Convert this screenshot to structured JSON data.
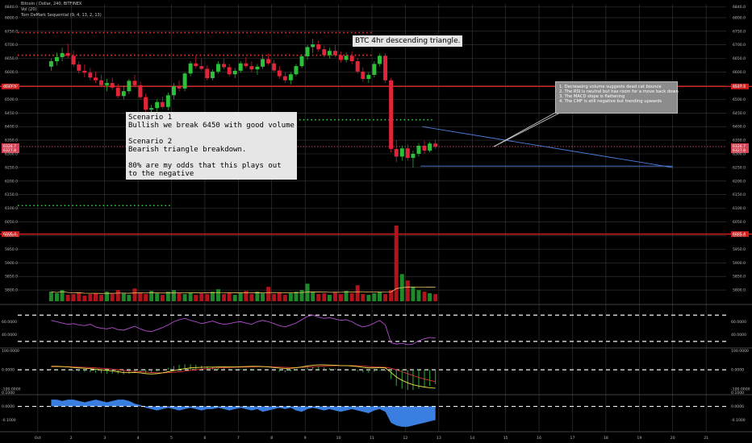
{
  "chart_data": {
    "type": "candlestick",
    "header": {
      "title": "Bitcoin / Dollar, 240, BITFINEX",
      "indicator_1": "Vol (20)",
      "indicator_2": "Tom DeMark Sequential (9, 4, 13, 2, 13)"
    },
    "annotations": {
      "title": "BTC 4hr descending triangle.",
      "scenarios": "Scenario 1\nBullish we break 6450 with good volume\n\nScenario 2\nBearish triangle breakdown.\n\n80% are my odds that this plays out\nto the negative",
      "callout": [
        "1. Decreasing volume suggests dead cat bounce",
        "2. The RSI is neutral but has room for a move back down",
        "3. The MACD slope is flattening",
        "4. The CMF is still negative but trending upwards"
      ]
    },
    "x_axis": {
      "ticks": [
        "Oct",
        "2",
        "3",
        "4",
        "5",
        "6",
        "7",
        "8",
        "9",
        "10",
        "11",
        "12",
        "13",
        "14",
        "15",
        "16",
        "17",
        "18",
        "19",
        "20",
        "21"
      ]
    },
    "price_axis": {
      "ylim": [
        5750,
        6850
      ],
      "ticks": [
        "6840.0",
        "6800.0",
        "6750.0",
        "6700.0",
        "6650.0",
        "6600.0",
        "6550.0",
        "6500.0",
        "6450.0",
        "6400.0",
        "6350.0",
        "6300.0",
        "6250.0",
        "6200.0",
        "6150.0",
        "6100.0",
        "6050.0",
        "6000.0",
        "5950.0",
        "5900.0",
        "5850.0",
        "5800.0"
      ],
      "levels": [
        6547.5,
        6005.4
      ],
      "level_labels": [
        "6547.5",
        "6005.4"
      ],
      "current_label": "6326.7",
      "current_label_2": "6327.8"
    },
    "support_resistance_dotted": [
      {
        "price": 6745,
        "color": "#ff3030"
      },
      {
        "price": 6662,
        "color": "#ff3030"
      },
      {
        "price": 6425,
        "color": "#2ecc40"
      },
      {
        "price": 6110,
        "color": "#2ecc40"
      }
    ],
    "triangle": {
      "upper": [
        [
          11.1,
          6400
        ],
        [
          18.6,
          6250
        ]
      ],
      "lower": [
        [
          11.05,
          6255
        ],
        [
          18.6,
          6255
        ]
      ]
    },
    "candles": [
      [
        0.0,
        6620,
        6650,
        6605,
        6640
      ],
      [
        0.17,
        6640,
        6672,
        6625,
        6655
      ],
      [
        0.33,
        6655,
        6690,
        6640,
        6670
      ],
      [
        0.5,
        6670,
        6705,
        6650,
        6660
      ],
      [
        0.67,
        6660,
        6680,
        6620,
        6628
      ],
      [
        0.83,
        6628,
        6640,
        6595,
        6605
      ],
      [
        1.0,
        6605,
        6628,
        6582,
        6598
      ],
      [
        1.17,
        6598,
        6615,
        6570,
        6580
      ],
      [
        1.33,
        6580,
        6602,
        6560,
        6570
      ],
      [
        1.5,
        6570,
        6590,
        6545,
        6552
      ],
      [
        1.67,
        6552,
        6575,
        6530,
        6560
      ],
      [
        1.83,
        6560,
        6580,
        6535,
        6543
      ],
      [
        2.0,
        6543,
        6558,
        6505,
        6512
      ],
      [
        2.17,
        6512,
        6550,
        6500,
        6530
      ],
      [
        2.33,
        6530,
        6575,
        6520,
        6568
      ],
      [
        2.5,
        6568,
        6590,
        6545,
        6552
      ],
      [
        2.67,
        6552,
        6565,
        6500,
        6508
      ],
      [
        2.83,
        6508,
        6520,
        6455,
        6462
      ],
      [
        3.0,
        6462,
        6480,
        6440,
        6468
      ],
      [
        3.17,
        6468,
        6500,
        6455,
        6490
      ],
      [
        3.33,
        6490,
        6510,
        6465,
        6472
      ],
      [
        3.5,
        6472,
        6525,
        6460,
        6515
      ],
      [
        3.67,
        6515,
        6560,
        6500,
        6548
      ],
      [
        3.83,
        6548,
        6570,
        6530,
        6540
      ],
      [
        4.0,
        6540,
        6600,
        6530,
        6595
      ],
      [
        4.17,
        6595,
        6640,
        6585,
        6632
      ],
      [
        4.33,
        6632,
        6660,
        6615,
        6622
      ],
      [
        4.5,
        6622,
        6650,
        6605,
        6612
      ],
      [
        4.67,
        6612,
        6625,
        6570,
        6578
      ],
      [
        4.83,
        6578,
        6610,
        6570,
        6602
      ],
      [
        5.0,
        6602,
        6640,
        6595,
        6630
      ],
      [
        5.17,
        6630,
        6650,
        6610,
        6618
      ],
      [
        5.33,
        6618,
        6630,
        6585,
        6592
      ],
      [
        5.5,
        6592,
        6615,
        6578,
        6605
      ],
      [
        5.67,
        6605,
        6640,
        6598,
        6632
      ],
      [
        5.83,
        6632,
        6655,
        6615,
        6622
      ],
      [
        6.0,
        6622,
        6640,
        6600,
        6610
      ],
      [
        6.17,
        6610,
        6630,
        6590,
        6620
      ],
      [
        6.33,
        6620,
        6660,
        6612,
        6648
      ],
      [
        6.5,
        6648,
        6668,
        6625,
        6632
      ],
      [
        6.67,
        6632,
        6645,
        6600,
        6606
      ],
      [
        6.83,
        6606,
        6622,
        6575,
        6585
      ],
      [
        7.0,
        6585,
        6600,
        6560,
        6570
      ],
      [
        7.17,
        6570,
        6600,
        6555,
        6592
      ],
      [
        7.33,
        6592,
        6630,
        6585,
        6622
      ],
      [
        7.5,
        6622,
        6665,
        6615,
        6658
      ],
      [
        7.67,
        6658,
        6700,
        6645,
        6692
      ],
      [
        7.83,
        6692,
        6722,
        6670,
        6702
      ],
      [
        8.0,
        6702,
        6715,
        6675,
        6684
      ],
      [
        8.17,
        6684,
        6698,
        6655,
        6662
      ],
      [
        8.33,
        6662,
        6690,
        6650,
        6678
      ],
      [
        8.5,
        6678,
        6700,
        6655,
        6662
      ],
      [
        8.67,
        6662,
        6675,
        6635,
        6645
      ],
      [
        8.83,
        6645,
        6672,
        6635,
        6660
      ],
      [
        9.0,
        6660,
        6675,
        6630,
        6640
      ],
      [
        9.17,
        6640,
        6652,
        6595,
        6602
      ],
      [
        9.33,
        6602,
        6618,
        6565,
        6575
      ],
      [
        9.5,
        6575,
        6600,
        6560,
        6590
      ],
      [
        9.67,
        6590,
        6640,
        6580,
        6630
      ],
      [
        9.83,
        6630,
        6668,
        6620,
        6660
      ],
      [
        10.0,
        6660,
        6670,
        6560,
        6570
      ],
      [
        10.17,
        6570,
        6578,
        6305,
        6318
      ],
      [
        10.33,
        6318,
        6350,
        6270,
        6290
      ],
      [
        10.5,
        6290,
        6330,
        6275,
        6320
      ],
      [
        10.67,
        6320,
        6335,
        6275,
        6285
      ],
      [
        10.83,
        6285,
        6312,
        6250,
        6300
      ],
      [
        11.0,
        6300,
        6340,
        6290,
        6330
      ],
      [
        11.17,
        6330,
        6348,
        6300,
        6312
      ],
      [
        11.33,
        6312,
        6345,
        6305,
        6338
      ],
      [
        11.5,
        6338,
        6352,
        6318,
        6326
      ]
    ],
    "x_domain": [
      -0.6,
      20.6
    ],
    "bar_x_offset": 0.4,
    "volume": [
      12,
      10,
      14,
      8,
      9,
      11,
      7,
      9,
      10,
      8,
      12,
      9,
      14,
      10,
      8,
      16,
      11,
      9,
      13,
      10,
      8,
      12,
      14,
      10,
      9,
      11,
      8,
      10,
      9,
      12,
      15,
      9,
      11,
      8,
      10,
      13,
      9,
      12,
      10,
      18,
      9,
      11,
      8,
      10,
      12,
      14,
      22,
      12,
      9,
      10,
      8,
      11,
      9,
      13,
      10,
      20,
      9,
      8,
      10,
      12,
      9,
      14,
      95,
      34,
      26,
      18,
      14,
      12,
      10,
      9
    ],
    "rsi": {
      "ylim": [
        20,
        85
      ],
      "ticks": [
        "60.0000",
        "40.0000"
      ],
      "guides": [
        70,
        30
      ],
      "values": [
        62,
        60,
        58,
        56,
        57,
        55,
        54,
        56,
        52,
        50,
        49,
        51,
        48,
        47,
        50,
        53,
        49,
        46,
        45,
        48,
        51,
        55,
        60,
        63,
        65,
        62,
        60,
        57,
        59,
        61,
        58,
        56,
        57,
        59,
        60,
        58,
        56,
        60,
        62,
        60,
        57,
        54,
        52,
        55,
        58,
        63,
        68,
        70,
        67,
        65,
        66,
        64,
        62,
        63,
        60,
        55,
        52,
        54,
        58,
        62,
        55,
        28,
        26,
        27,
        25,
        26,
        31,
        34,
        36,
        35
      ]
    },
    "macd": {
      "ylim": [
        -130,
        110
      ],
      "ticks": [
        "100.0000",
        "0.0000",
        "-100.0000"
      ],
      "guide": 0,
      "macd": [
        18,
        18,
        17,
        15,
        12,
        10,
        8,
        6,
        3,
        0,
        -3,
        -6,
        -10,
        -14,
        -15,
        -14,
        -16,
        -20,
        -22,
        -20,
        -16,
        -10,
        -4,
        2,
        6,
        10,
        12,
        13,
        14,
        14,
        15,
        16,
        15,
        15,
        16,
        17,
        18,
        18,
        17,
        15,
        12,
        9,
        7,
        8,
        11,
        15,
        20,
        24,
        26,
        26,
        25,
        24,
        22,
        22,
        20,
        17,
        13,
        10,
        10,
        12,
        10,
        -14,
        -38,
        -55,
        -68,
        -78,
        -85,
        -90,
        -94,
        -96
      ],
      "signal": [
        16,
        16,
        16,
        16,
        15,
        14,
        13,
        12,
        10,
        8,
        6,
        3,
        0,
        -3,
        -6,
        -8,
        -10,
        -12,
        -14,
        -16,
        -16,
        -15,
        -13,
        -10,
        -7,
        -3,
        0,
        3,
        6,
        8,
        10,
        11,
        12,
        13,
        14,
        14,
        15,
        16,
        16,
        16,
        15,
        14,
        13,
        12,
        12,
        13,
        14,
        16,
        18,
        20,
        21,
        22,
        22,
        22,
        22,
        21,
        19,
        17,
        15,
        14,
        13,
        8,
        0,
        -10,
        -20,
        -30,
        -40,
        -48,
        -55,
        -62
      ]
    },
    "cmf": {
      "ylim": [
        -0.18,
        0.08
      ],
      "ticks": [
        "0.1000",
        "0.0000",
        "-0.1000"
      ],
      "guide": 0,
      "values": [
        0.05,
        0.05,
        0.04,
        0.05,
        0.05,
        0.04,
        0.03,
        0.04,
        0.05,
        0.04,
        0.03,
        0.04,
        0.05,
        0.05,
        0.04,
        0.02,
        0.01,
        -0.01,
        -0.02,
        -0.03,
        -0.02,
        -0.01,
        -0.02,
        -0.03,
        -0.02,
        -0.01,
        -0.02,
        -0.03,
        -0.02,
        -0.02,
        -0.01,
        -0.02,
        -0.03,
        -0.02,
        -0.01,
        -0.02,
        -0.03,
        -0.02,
        -0.04,
        -0.03,
        -0.02,
        -0.01,
        -0.02,
        -0.01,
        -0.03,
        -0.04,
        -0.02,
        -0.01,
        -0.02,
        -0.03,
        -0.02,
        -0.03,
        -0.04,
        -0.03,
        -0.02,
        -0.03,
        -0.04,
        -0.05,
        -0.03,
        -0.02,
        -0.04,
        -0.12,
        -0.14,
        -0.15,
        -0.15,
        -0.14,
        -0.13,
        -0.12,
        -0.11,
        -0.1
      ]
    }
  }
}
